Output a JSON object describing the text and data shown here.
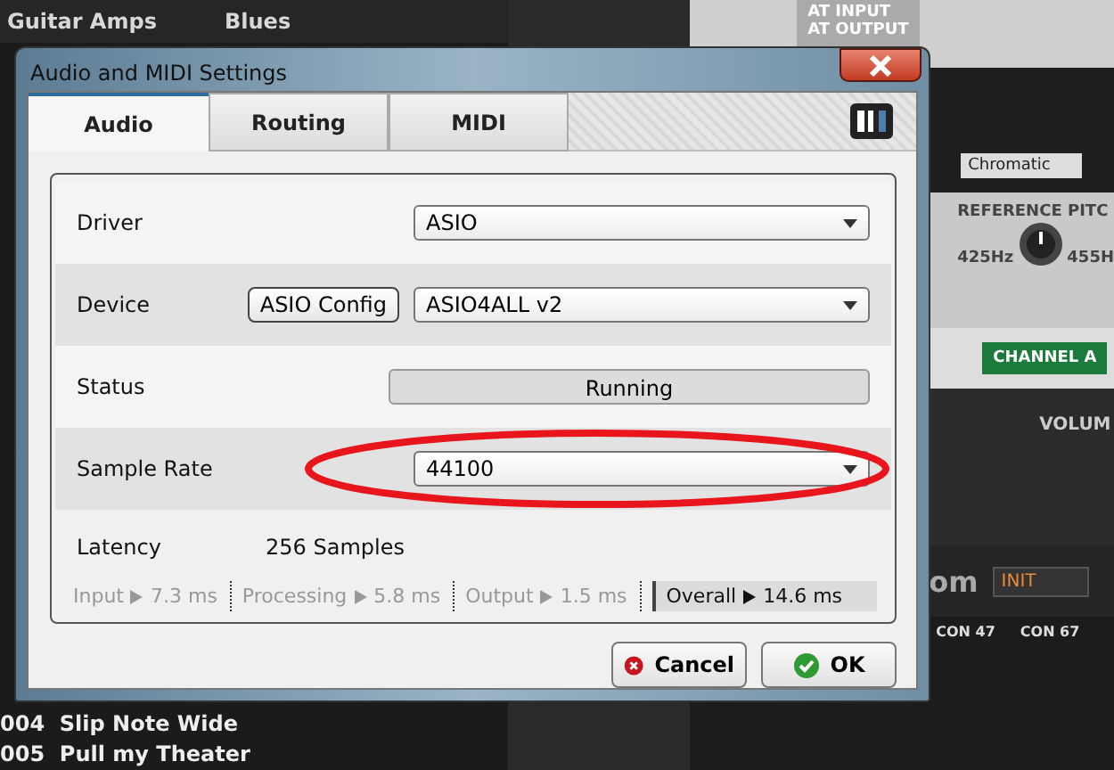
{
  "background": {
    "browser": {
      "header": [
        "Guitar Amps",
        "Blues"
      ],
      "presets": [
        {
          "number": "004",
          "name": "Slip Note Wide"
        },
        {
          "number": "005",
          "name": "Pull my Theater"
        }
      ]
    },
    "rack": {
      "meter_labels": [
        "AT INPUT",
        "AT OUTPUT"
      ],
      "scale_field": "Chromatic",
      "pitch_title": "REFERENCE PITC",
      "pitch_low": "425Hz",
      "pitch_high": "455H",
      "channel": "CHANNEL A",
      "volume": "VOLUM",
      "preset_suffix": "om",
      "preset_field": "INIT",
      "controls": [
        "CON 47",
        "CON 67"
      ]
    }
  },
  "dialog": {
    "title": "Audio and MIDI Settings",
    "tabs": [
      {
        "label": "Audio",
        "selected": true
      },
      {
        "label": "Routing",
        "selected": false
      },
      {
        "label": "MIDI",
        "selected": false
      }
    ],
    "settings": [
      {
        "kind": "dropdown",
        "label": "Driver",
        "value": "ASIO",
        "highlighted": false
      },
      {
        "kind": "device",
        "label": "Device",
        "button": "ASIO Config",
        "value": "ASIO4ALL v2",
        "highlighted": false
      },
      {
        "kind": "status",
        "label": "Status",
        "value": "Running",
        "highlighted": false
      },
      {
        "kind": "dropdown",
        "label": "Sample Rate",
        "value": "44100",
        "highlighted": true
      }
    ],
    "latency": {
      "label": "Latency",
      "value": "256 Samples",
      "breakdown": [
        {
          "label": "Input",
          "value": "7.3 ms",
          "selected": false
        },
        {
          "label": "Processing",
          "value": "5.8 ms",
          "selected": false
        },
        {
          "label": "Output",
          "value": "1.5 ms",
          "selected": false
        },
        {
          "label": "Overall",
          "value": "14.6 ms",
          "selected": true
        }
      ]
    },
    "buttons": [
      {
        "kind": "cancel",
        "label": "Cancel"
      },
      {
        "kind": "ok",
        "label": "OK"
      }
    ]
  }
}
